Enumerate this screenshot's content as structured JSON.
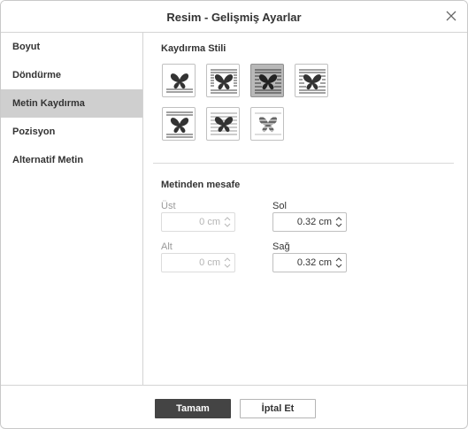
{
  "dialog": {
    "title": "Resim - Gelişmiş Ayarlar",
    "close_icon": "close-icon"
  },
  "sidebar": {
    "items": [
      {
        "label": "Boyut",
        "active": false
      },
      {
        "label": "Döndürme",
        "active": false
      },
      {
        "label": "Metin Kaydırma",
        "active": true
      },
      {
        "label": "Pozisyon",
        "active": false
      },
      {
        "label": "Alternatif Metin",
        "active": false
      }
    ]
  },
  "wrapping": {
    "title": "Kaydırma Stili",
    "styles": [
      {
        "name": "inline",
        "icon": "wrap-inline-icon",
        "selected": false
      },
      {
        "name": "square",
        "icon": "wrap-square-icon",
        "selected": false
      },
      {
        "name": "tight",
        "icon": "wrap-tight-icon",
        "selected": true
      },
      {
        "name": "through",
        "icon": "wrap-through-icon",
        "selected": false
      },
      {
        "name": "top-bottom",
        "icon": "wrap-top-bottom-icon",
        "selected": false
      },
      {
        "name": "in-front",
        "icon": "wrap-in-front-icon",
        "selected": false
      },
      {
        "name": "behind",
        "icon": "wrap-behind-icon",
        "selected": false
      }
    ]
  },
  "distance": {
    "title": "Metinden mesafe",
    "top": {
      "label": "Üst",
      "value": "0 cm",
      "disabled": true
    },
    "left": {
      "label": "Sol",
      "value": "0.32 cm",
      "disabled": false
    },
    "bottom": {
      "label": "Alt",
      "value": "0 cm",
      "disabled": true
    },
    "right": {
      "label": "Sağ",
      "value": "0.32 cm",
      "disabled": false
    }
  },
  "footer": {
    "ok_label": "Tamam",
    "cancel_label": "İptal Et"
  },
  "colors": {
    "primary_button": "#444444",
    "active_sidebar": "#cfcfcf",
    "selected_style": "#b8b8b8"
  }
}
